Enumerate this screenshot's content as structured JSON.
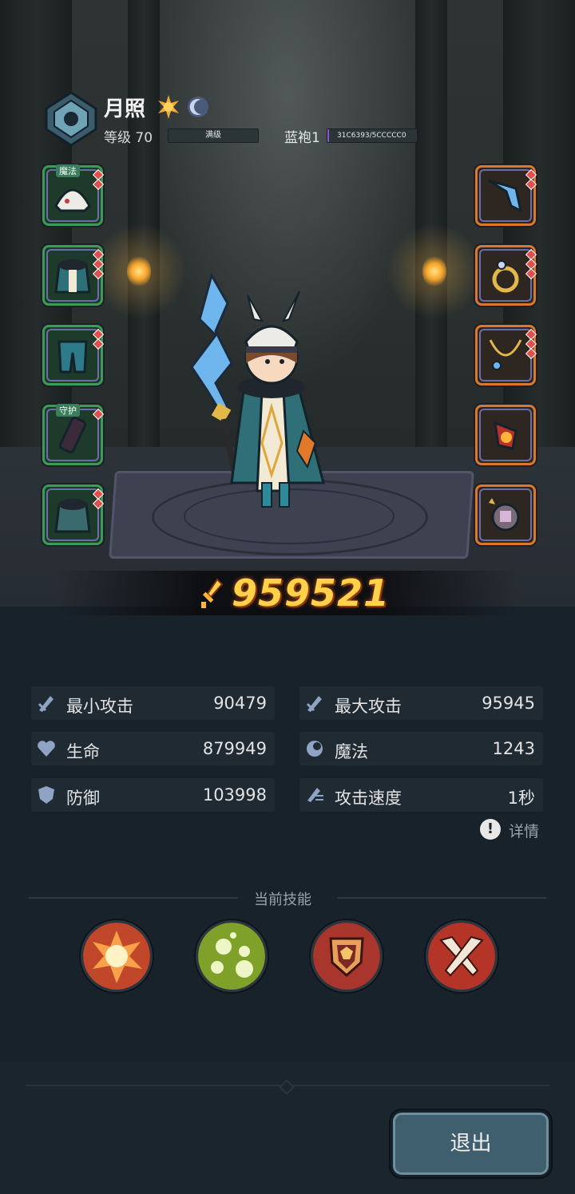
{
  "hero": {
    "name": "月照",
    "level_label": "等级 70",
    "level_bar_text": "满级",
    "robe_label": "蓝袍1",
    "robe_progress_text": "31C6393/5CCCCC0",
    "robe_progress_fraction": 0.02
  },
  "equipment": {
    "left": [
      {
        "name": "helmet",
        "tag": "魔法"
      },
      {
        "name": "armor",
        "tag": ""
      },
      {
        "name": "pants",
        "tag": ""
      },
      {
        "name": "gloves",
        "tag": "守护"
      },
      {
        "name": "cloak",
        "tag": ""
      }
    ],
    "right": [
      {
        "name": "weapon",
        "tag": ""
      },
      {
        "name": "ring",
        "tag": ""
      },
      {
        "name": "necklace",
        "tag": ""
      },
      {
        "name": "charm",
        "tag": ""
      },
      {
        "name": "relic",
        "tag": ""
      }
    ]
  },
  "power": "959521",
  "stats": [
    {
      "label": "最小攻击",
      "value": "90479",
      "icon": "sword-icon"
    },
    {
      "label": "最大攻击",
      "value": "95945",
      "icon": "sword-icon"
    },
    {
      "label": "生命",
      "value": "879949",
      "icon": "heart-icon"
    },
    {
      "label": "魔法",
      "value": "1243",
      "icon": "magic-icon"
    },
    {
      "label": "防御",
      "value": "103998",
      "icon": "shield-icon"
    },
    {
      "label": "攻击速度",
      "value": "1秒",
      "icon": "speed-icon"
    }
  ],
  "detail_label": "详情",
  "skills_title": "当前技能",
  "skills": [
    {
      "name": "explosion-skill",
      "color": "#c0472a"
    },
    {
      "name": "poison-skill",
      "color": "#7fa12a"
    },
    {
      "name": "guard-skill",
      "color": "#a8362c"
    },
    {
      "name": "cross-blades-skill",
      "color": "#b53428"
    }
  ],
  "exit_label": "退出",
  "colors": {
    "power": "#ffd24a",
    "green_slot": "#3c9b58",
    "orange_slot": "#d9782e",
    "robe_progress": "#8a53d6"
  }
}
